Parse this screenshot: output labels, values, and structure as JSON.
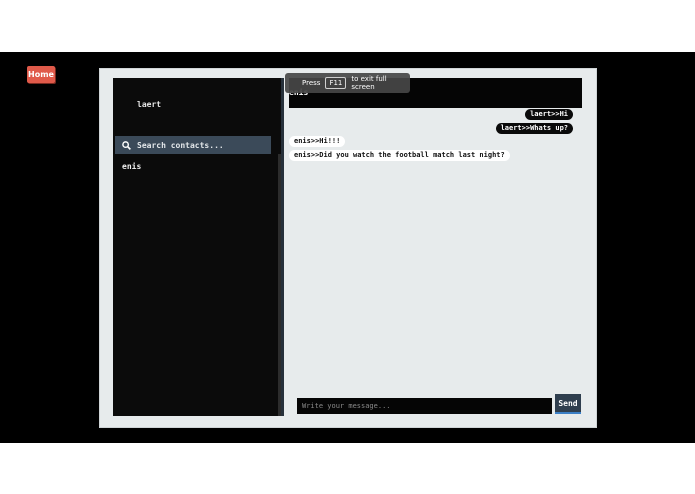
{
  "home_button": "Home",
  "sidebar": {
    "current_user": "laert",
    "search_placeholder": "Search contacts...",
    "contacts": [
      "enis"
    ]
  },
  "chat": {
    "header_name": "enis",
    "fullscreen_notice": {
      "before": "Press",
      "key": "F11",
      "after": "to exit full screen"
    },
    "messages": [
      {
        "text": "laert>>Hi",
        "direction": "out"
      },
      {
        "text": "laert>>Whats up?",
        "direction": "out"
      },
      {
        "text": "enis>>Hi!!!",
        "direction": "in"
      },
      {
        "text": "enis>>Did you watch the football match last night?",
        "direction": "in"
      }
    ],
    "composer_placeholder": "Write your message...",
    "send_label": "Send"
  },
  "colors": {
    "home_button": "#e05a4a",
    "panel_background": "#e7ebec",
    "sidebar_background": "#0b0b0b",
    "search_background": "#3b4a59",
    "send_button": "#2f3e4e"
  }
}
